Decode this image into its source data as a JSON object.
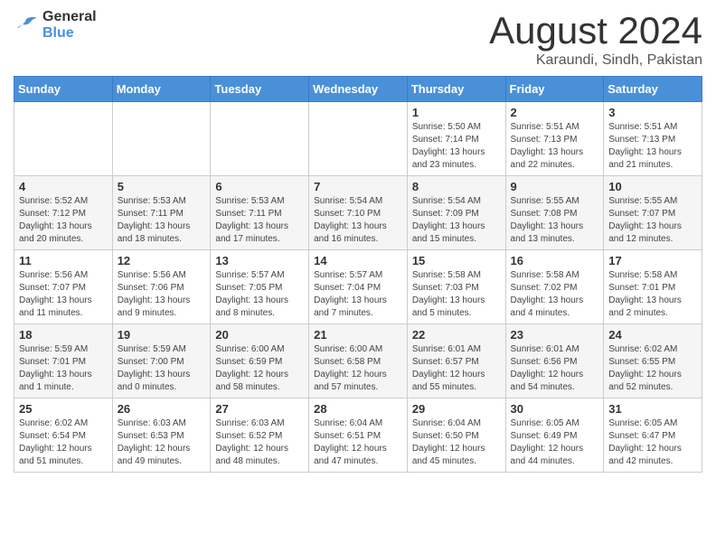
{
  "logo": {
    "general": "General",
    "blue": "Blue"
  },
  "title": {
    "month_year": "August 2024",
    "location": "Karaundi, Sindh, Pakistan"
  },
  "weekdays": [
    "Sunday",
    "Monday",
    "Tuesday",
    "Wednesday",
    "Thursday",
    "Friday",
    "Saturday"
  ],
  "weeks": [
    [
      {
        "day": "",
        "info": ""
      },
      {
        "day": "",
        "info": ""
      },
      {
        "day": "",
        "info": ""
      },
      {
        "day": "",
        "info": ""
      },
      {
        "day": "1",
        "info": "Sunrise: 5:50 AM\nSunset: 7:14 PM\nDaylight: 13 hours\nand 23 minutes."
      },
      {
        "day": "2",
        "info": "Sunrise: 5:51 AM\nSunset: 7:13 PM\nDaylight: 13 hours\nand 22 minutes."
      },
      {
        "day": "3",
        "info": "Sunrise: 5:51 AM\nSunset: 7:13 PM\nDaylight: 13 hours\nand 21 minutes."
      }
    ],
    [
      {
        "day": "4",
        "info": "Sunrise: 5:52 AM\nSunset: 7:12 PM\nDaylight: 13 hours\nand 20 minutes."
      },
      {
        "day": "5",
        "info": "Sunrise: 5:53 AM\nSunset: 7:11 PM\nDaylight: 13 hours\nand 18 minutes."
      },
      {
        "day": "6",
        "info": "Sunrise: 5:53 AM\nSunset: 7:11 PM\nDaylight: 13 hours\nand 17 minutes."
      },
      {
        "day": "7",
        "info": "Sunrise: 5:54 AM\nSunset: 7:10 PM\nDaylight: 13 hours\nand 16 minutes."
      },
      {
        "day": "8",
        "info": "Sunrise: 5:54 AM\nSunset: 7:09 PM\nDaylight: 13 hours\nand 15 minutes."
      },
      {
        "day": "9",
        "info": "Sunrise: 5:55 AM\nSunset: 7:08 PM\nDaylight: 13 hours\nand 13 minutes."
      },
      {
        "day": "10",
        "info": "Sunrise: 5:55 AM\nSunset: 7:07 PM\nDaylight: 13 hours\nand 12 minutes."
      }
    ],
    [
      {
        "day": "11",
        "info": "Sunrise: 5:56 AM\nSunset: 7:07 PM\nDaylight: 13 hours\nand 11 minutes."
      },
      {
        "day": "12",
        "info": "Sunrise: 5:56 AM\nSunset: 7:06 PM\nDaylight: 13 hours\nand 9 minutes."
      },
      {
        "day": "13",
        "info": "Sunrise: 5:57 AM\nSunset: 7:05 PM\nDaylight: 13 hours\nand 8 minutes."
      },
      {
        "day": "14",
        "info": "Sunrise: 5:57 AM\nSunset: 7:04 PM\nDaylight: 13 hours\nand 7 minutes."
      },
      {
        "day": "15",
        "info": "Sunrise: 5:58 AM\nSunset: 7:03 PM\nDaylight: 13 hours\nand 5 minutes."
      },
      {
        "day": "16",
        "info": "Sunrise: 5:58 AM\nSunset: 7:02 PM\nDaylight: 13 hours\nand 4 minutes."
      },
      {
        "day": "17",
        "info": "Sunrise: 5:58 AM\nSunset: 7:01 PM\nDaylight: 13 hours\nand 2 minutes."
      }
    ],
    [
      {
        "day": "18",
        "info": "Sunrise: 5:59 AM\nSunset: 7:01 PM\nDaylight: 13 hours\nand 1 minute."
      },
      {
        "day": "19",
        "info": "Sunrise: 5:59 AM\nSunset: 7:00 PM\nDaylight: 13 hours\nand 0 minutes."
      },
      {
        "day": "20",
        "info": "Sunrise: 6:00 AM\nSunset: 6:59 PM\nDaylight: 12 hours\nand 58 minutes."
      },
      {
        "day": "21",
        "info": "Sunrise: 6:00 AM\nSunset: 6:58 PM\nDaylight: 12 hours\nand 57 minutes."
      },
      {
        "day": "22",
        "info": "Sunrise: 6:01 AM\nSunset: 6:57 PM\nDaylight: 12 hours\nand 55 minutes."
      },
      {
        "day": "23",
        "info": "Sunrise: 6:01 AM\nSunset: 6:56 PM\nDaylight: 12 hours\nand 54 minutes."
      },
      {
        "day": "24",
        "info": "Sunrise: 6:02 AM\nSunset: 6:55 PM\nDaylight: 12 hours\nand 52 minutes."
      }
    ],
    [
      {
        "day": "25",
        "info": "Sunrise: 6:02 AM\nSunset: 6:54 PM\nDaylight: 12 hours\nand 51 minutes."
      },
      {
        "day": "26",
        "info": "Sunrise: 6:03 AM\nSunset: 6:53 PM\nDaylight: 12 hours\nand 49 minutes."
      },
      {
        "day": "27",
        "info": "Sunrise: 6:03 AM\nSunset: 6:52 PM\nDaylight: 12 hours\nand 48 minutes."
      },
      {
        "day": "28",
        "info": "Sunrise: 6:04 AM\nSunset: 6:51 PM\nDaylight: 12 hours\nand 47 minutes."
      },
      {
        "day": "29",
        "info": "Sunrise: 6:04 AM\nSunset: 6:50 PM\nDaylight: 12 hours\nand 45 minutes."
      },
      {
        "day": "30",
        "info": "Sunrise: 6:05 AM\nSunset: 6:49 PM\nDaylight: 12 hours\nand 44 minutes."
      },
      {
        "day": "31",
        "info": "Sunrise: 6:05 AM\nSunset: 6:47 PM\nDaylight: 12 hours\nand 42 minutes."
      }
    ]
  ]
}
